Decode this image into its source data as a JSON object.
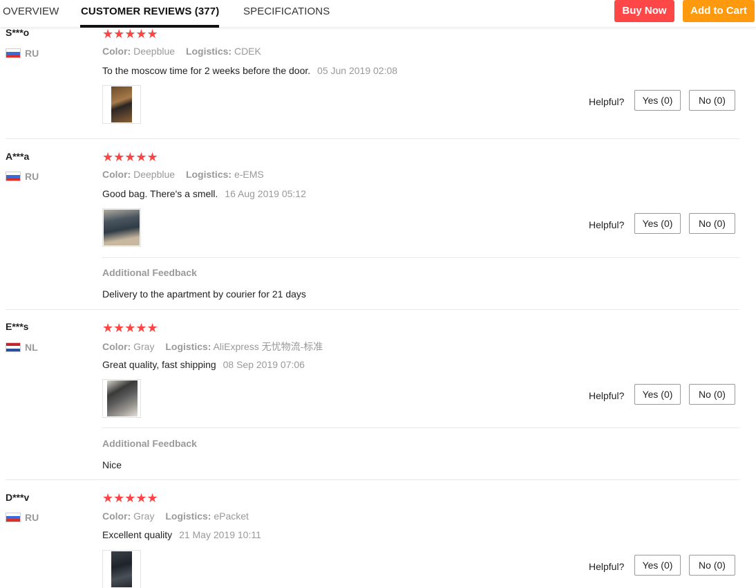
{
  "tabs": {
    "overview": "OVERVIEW",
    "reviews": "CUSTOMER REVIEWS (377)",
    "specifications": "SPECIFICATIONS"
  },
  "actions": {
    "buy_now": "Buy Now",
    "add_to_cart": "Add to Cart"
  },
  "reviews": [
    {
      "name": "S***o",
      "country": "RU",
      "stars": "★★★★★",
      "color_label": "Color:",
      "color": "Deepblue",
      "logistics_label": "Logistics:",
      "logistics": "CDEK",
      "text": "To the moscow time for 2 weeks before the door.",
      "date": "05 Jun 2019 02:08",
      "helpful": "Helpful?",
      "yes": "Yes (0)",
      "no": "No (0)"
    },
    {
      "name": "A***a",
      "country": "RU",
      "stars": "★★★★★",
      "color_label": "Color:",
      "color": "Deepblue",
      "logistics_label": "Logistics:",
      "logistics": "e-EMS",
      "text": "Good bag. There's a smell.",
      "date": "16 Aug 2019 05:12",
      "helpful": "Helpful?",
      "yes": "Yes (0)",
      "no": "No (0)",
      "additional_title": "Additional Feedback",
      "additional_text": "Delivery to the apartment by courier for 21 days"
    },
    {
      "name": "E***s",
      "country": "NL",
      "stars": "★★★★★",
      "color_label": "Color:",
      "color": "Gray",
      "logistics_label": "Logistics:",
      "logistics": "AliExpress 无忧物流-标准",
      "text": "Great quality, fast shipping",
      "date": "08 Sep 2019 07:06",
      "helpful": "Helpful?",
      "yes": "Yes (0)",
      "no": "No (0)",
      "additional_title": "Additional Feedback",
      "additional_text": "Nice"
    },
    {
      "name": "D***v",
      "country": "RU",
      "stars": "★★★★★",
      "color_label": "Color:",
      "color": "Gray",
      "logistics_label": "Logistics:",
      "logistics": "ePacket",
      "text": "Excellent quality",
      "date": "21 May 2019 10:11",
      "helpful": "Helpful?",
      "yes": "Yes (0)",
      "no": "No (0)"
    }
  ],
  "colors": {
    "star": "#ff4444",
    "buy_now": "#ff4747",
    "add_to_cart": "#ff9a0f"
  }
}
